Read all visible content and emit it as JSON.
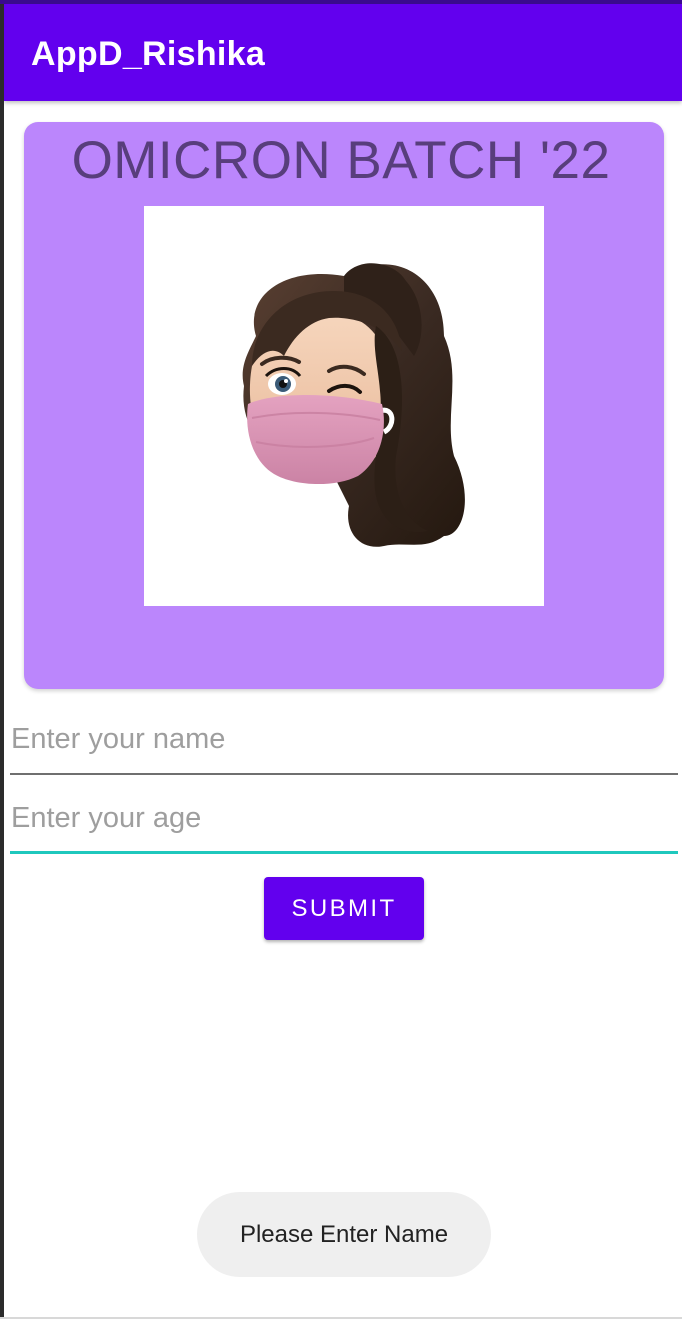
{
  "app_bar": {
    "title": "AppD_Rishika",
    "color": "#6200ee"
  },
  "card": {
    "title": "OMICRON BATCH '22",
    "background": "#bb86fc",
    "title_color": "#583e7c",
    "image": "memoji-avatar-with-pink-mask-winking"
  },
  "form": {
    "name_placeholder": "Enter your name",
    "age_placeholder": "Enter your age",
    "focused_field_color": "#1fc8bd",
    "submit_label": "SUBMIT"
  },
  "toast": {
    "message": "Please Enter Name"
  }
}
